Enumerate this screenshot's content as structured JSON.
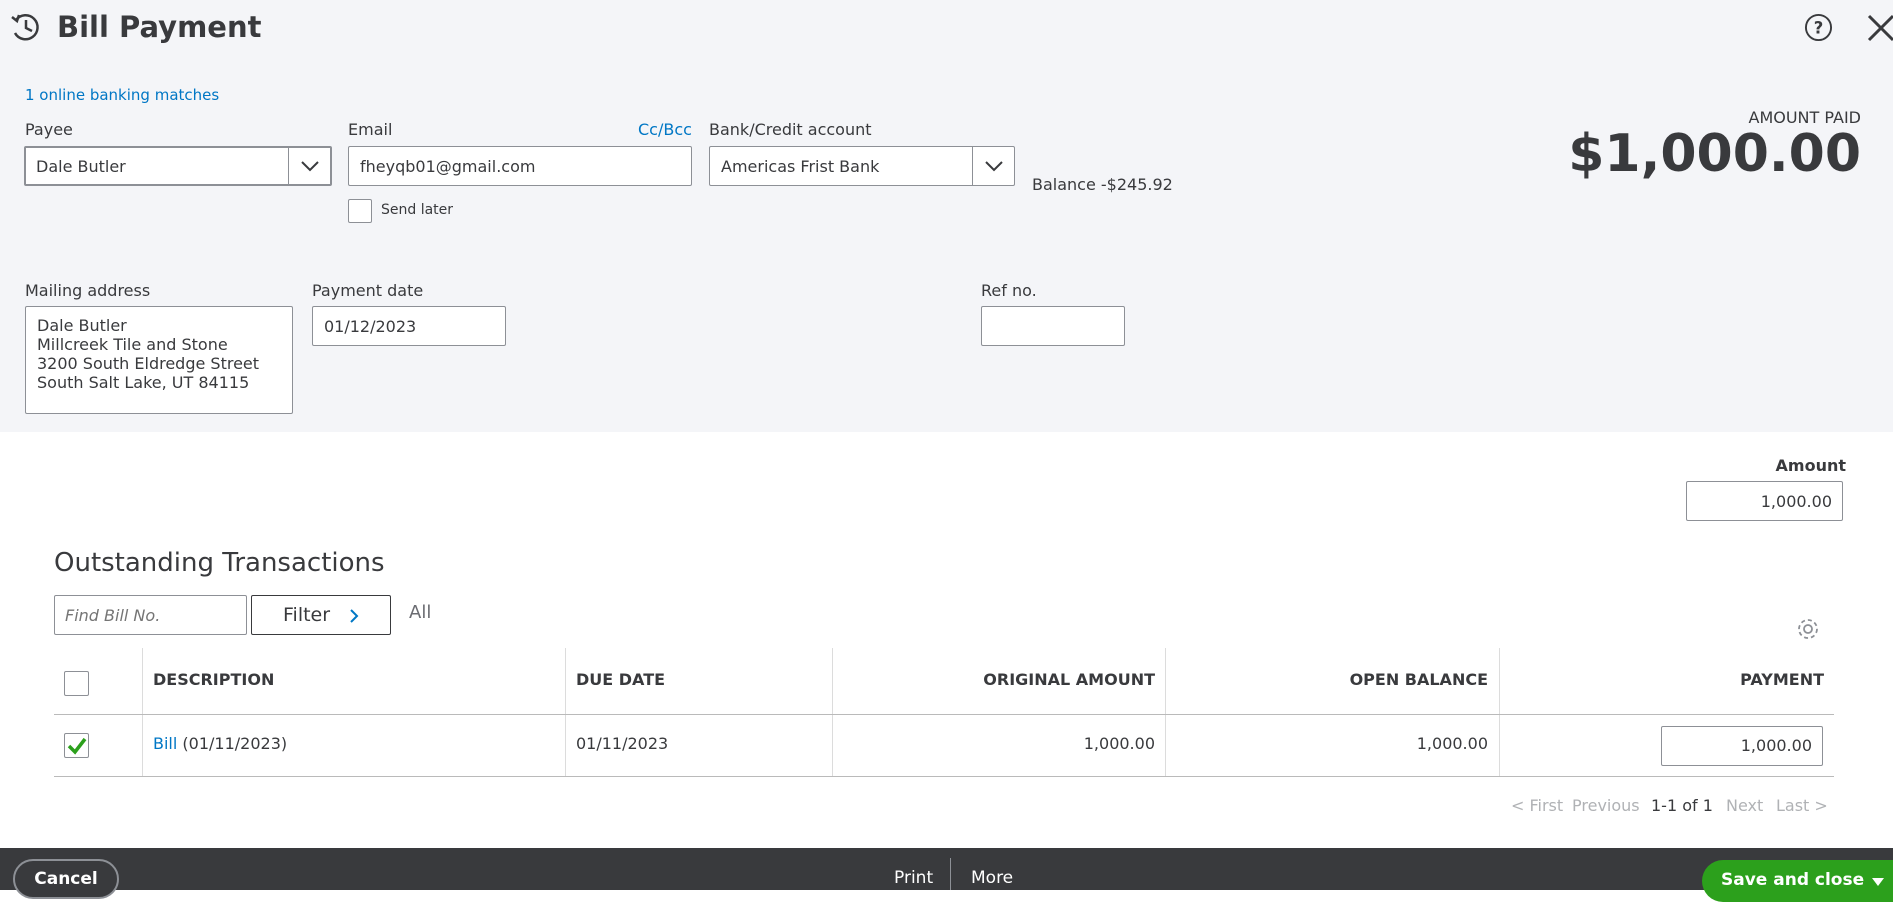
{
  "header": {
    "title": "Bill Payment",
    "icon": "bill-payment-clock-icon",
    "help_icon": "question-circle-icon",
    "close_icon": "close-icon"
  },
  "form": {
    "banking_matches": "1 online banking matches",
    "payee": {
      "label": "Payee",
      "value": "Dale Butler"
    },
    "email": {
      "label": "Email",
      "value": "fheyqb01@gmail.com",
      "cc_bcc": "Cc/Bcc",
      "send_later": "Send later"
    },
    "bank_account": {
      "label": "Bank/Credit account",
      "value": "Americas Frist Bank",
      "balance_label": "Balance",
      "balance_value": "-$245.92"
    },
    "amount_paid": {
      "label": "AMOUNT PAID",
      "value": "$1,000.00"
    },
    "mailing_address": {
      "label": "Mailing address",
      "lines": [
        "Dale Butler",
        "Millcreek Tile and Stone",
        "3200 South Eldredge Street",
        "South Salt Lake, UT  84115"
      ]
    },
    "payment_date": {
      "label": "Payment date",
      "value": "01/12/2023"
    },
    "ref_no": {
      "label": "Ref no.",
      "value": ""
    }
  },
  "amount": {
    "label": "Amount",
    "value": "1,000.00"
  },
  "outstanding": {
    "title": "Outstanding Transactions",
    "search_placeholder": "Find Bill No.",
    "filter_label": "Filter",
    "all_label": "All",
    "columns": [
      "DESCRIPTION",
      "DUE DATE",
      "ORIGINAL AMOUNT",
      "OPEN BALANCE",
      "PAYMENT"
    ],
    "rows": [
      {
        "checked": true,
        "link": "Bill",
        "desc_rest": "(01/11/2023)",
        "due_date": "01/11/2023",
        "original": "1,000.00",
        "open": "1,000.00",
        "payment": "1,000.00"
      }
    ],
    "pager": {
      "first": "< First",
      "previous": "Previous",
      "range": "1-1 of 1",
      "next": "Next",
      "last": "Last >"
    }
  },
  "footer": {
    "cancel": "Cancel",
    "print": "Print",
    "more": "More",
    "save": "Save and close"
  },
  "colors": {
    "accent": "#0077c5",
    "save_green": "#2ca01c",
    "footer_bg": "#393a3d",
    "top_bg": "#f4f5f8"
  }
}
